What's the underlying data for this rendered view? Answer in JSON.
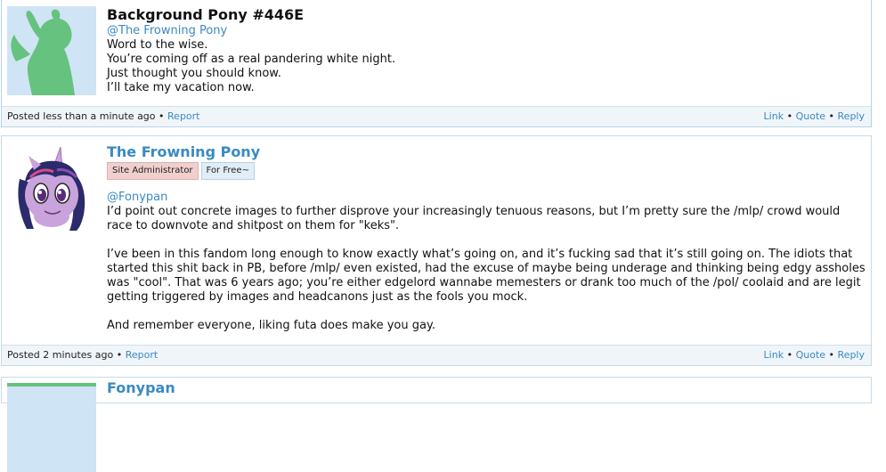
{
  "comments": [
    {
      "author": "Background Pony #446E",
      "mention": "@The Frowning Pony",
      "text": "Word to the wise.\nYou’re coming off as a real pandering white night.\nJust thought you should know.\nI’ll take my vacation now.",
      "posted": "Posted less than a minute ago",
      "report": "Report",
      "link": "Link",
      "quote": "Quote",
      "reply": "Reply"
    },
    {
      "author": "The Frowning Pony",
      "badges": [
        "Site Administrator",
        "For Free~"
      ],
      "mention": "@Fonypan",
      "text": "I’d point out concrete images to further disprove your increasingly tenuous reasons, but I’m pretty sure the /mlp/ crowd would race to downvote and shitpost on them for \"keks\".\n\nI’ve been in this fandom long enough to know exactly what’s going on, and it’s fucking sad that it’s still going on. The idiots that started this shit back in PB, before /mlp/ even existed, had the excuse of maybe being underage and thinking being edgy assholes was \"cool\". That was 6 years ago; you’re either edgelord wannabe memesters or drank too much of the /pol/ coolaid and are legit getting triggered by images and headcanons just as the fools you mock.\n\nAnd remember everyone, liking futa does make you gay.",
      "posted": "Posted 2 minutes ago",
      "report": "Report",
      "link": "Link",
      "quote": "Quote",
      "reply": "Reply"
    },
    {
      "author": "Fonypan"
    }
  ],
  "bullet": "•",
  "colors": {
    "link": "#3a8ac2",
    "footer_bg": "#f0f5f9",
    "border": "#c7dbe8",
    "admin_badge": "#f1cfcf",
    "free_badge": "#e1eef8"
  }
}
